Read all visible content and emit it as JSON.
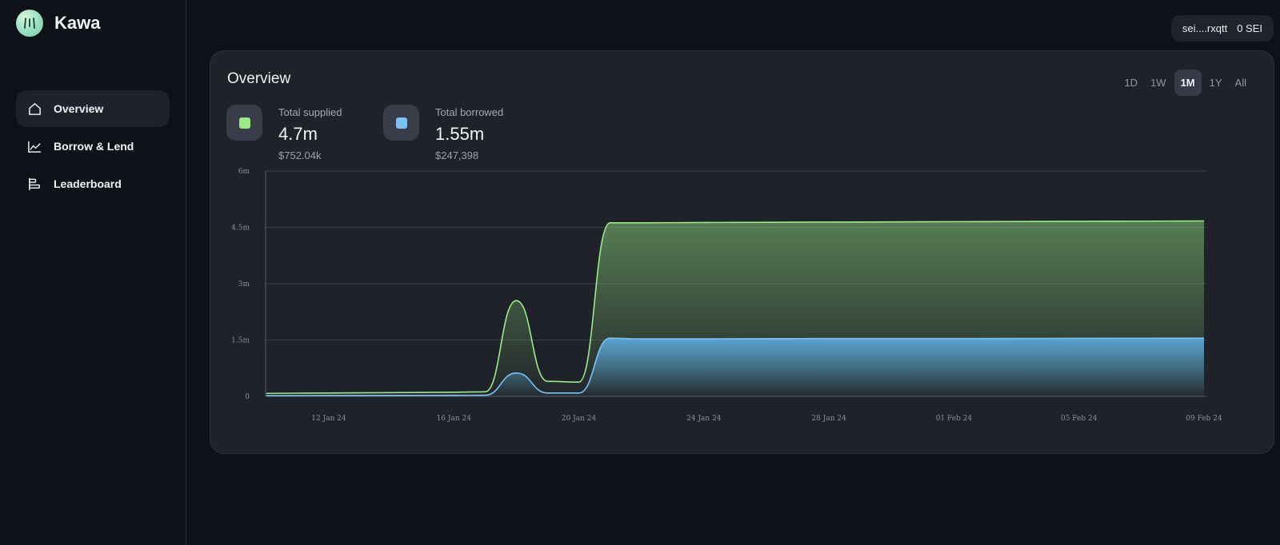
{
  "app": {
    "name": "Kawa"
  },
  "sidebar": {
    "items": [
      {
        "label": "Overview",
        "icon": "home-icon",
        "active": true
      },
      {
        "label": "Borrow & Lend",
        "icon": "line-chart-icon",
        "active": false
      },
      {
        "label": "Leaderboard",
        "icon": "leaderboard-icon",
        "active": false
      }
    ]
  },
  "wallet": {
    "address": "sei....rxqtt",
    "balance": "0 SEI"
  },
  "overview": {
    "title": "Overview",
    "ranges": [
      {
        "label": "1D",
        "active": false
      },
      {
        "label": "1W",
        "active": false
      },
      {
        "label": "1M",
        "active": true
      },
      {
        "label": "1Y",
        "active": false
      },
      {
        "label": "All",
        "active": false
      }
    ],
    "supplied": {
      "label": "Total supplied",
      "value": "4.7m",
      "usd": "$752.04k",
      "color": "#9bec86"
    },
    "borrowed": {
      "label": "Total borrowed",
      "value": "1.55m",
      "usd": "$247,398",
      "color": "#7cc2f6"
    }
  },
  "chart_data": {
    "type": "area",
    "x_ticks": [
      "12 Jan 24",
      "16 Jan 24",
      "20 Jan 24",
      "24 Jan 24",
      "28 Jan 24",
      "01 Feb 24",
      "05 Feb 24",
      "09 Feb 24"
    ],
    "y_ticks": [
      "0",
      "1.5m",
      "3m",
      "4.5m",
      "6m"
    ],
    "ylim": [
      0,
      6000000
    ],
    "x": [
      "10 Jan 24",
      "12 Jan 24",
      "14 Jan 24",
      "16 Jan 24",
      "17 Jan 24",
      "18 Jan 24",
      "19 Jan 24",
      "20 Jan 24",
      "21 Jan 24",
      "22 Jan 24",
      "24 Jan 24",
      "28 Jan 24",
      "01 Feb 24",
      "05 Feb 24",
      "09 Feb 24"
    ],
    "series": [
      {
        "color": "#9bec86",
        "values": [
          80000,
          90000,
          100000,
          110000,
          120000,
          2550000,
          400000,
          380000,
          4620000,
          4620000,
          4630000,
          4640000,
          4650000,
          4660000,
          4670000
        ]
      },
      {
        "color": "#7cc2f6",
        "values": [
          20000,
          22000,
          25000,
          28000,
          30000,
          620000,
          90000,
          90000,
          1550000,
          1530000,
          1530000,
          1540000,
          1540000,
          1545000,
          1550000
        ]
      }
    ],
    "grid": true,
    "legend": "none"
  }
}
